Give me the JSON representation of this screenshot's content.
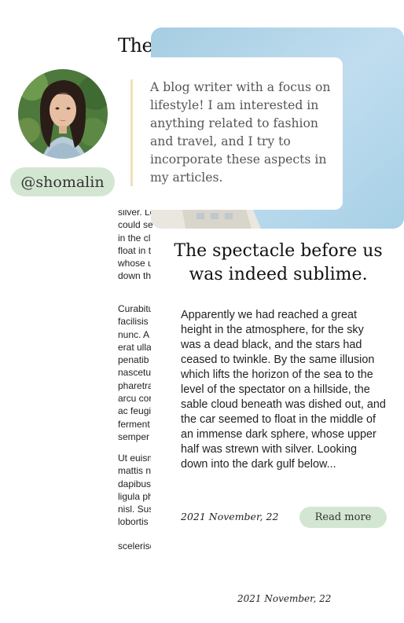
{
  "article": {
    "title_partial": "The",
    "para1": "silver. Lo\ncould se\nin the cl\nfloat in t\nwhose u\ndown th",
    "para2": "Curabitu\nfacilisis\nnunc. A\nerat ulla\npenatib\nnascetu\npharetra\narcu cor\nac feugi\nferment\nsemper",
    "para3": "Ut euism\nmattis n\ndapibus\nligula ph\nnisl. Sus\nlobortis\ncondim",
    "tail": "scelerisque sem porta at.",
    "date": "2021 November, 22"
  },
  "profile": {
    "handle": "@shomalin",
    "bio": "A blog writer with a focus on lifestyle! I am interested in anything related to fashion and travel, and I try to incorporate these aspects in my articles."
  },
  "card": {
    "title": "The spectacle before us was indeed sublime.",
    "excerpt": "Apparently we had reached a great height in the atmosphere, for the sky was a dead black, and the stars had ceased to twinkle. By the same illusion which lifts the horizon of the sea to the level of the spectator on a hillside, the sable cloud beneath was dished out, and the car seemed to float in the middle of an immense dark sphere, whose upper half was strewn with silver. Looking down into the dark gulf below...",
    "date": "2021 November, 22",
    "read_more": "Read more"
  },
  "colors": {
    "pill_green": "#d3e6d2",
    "bio_bar": "#f2dfb8",
    "image_sky": "#a8cfe3"
  }
}
